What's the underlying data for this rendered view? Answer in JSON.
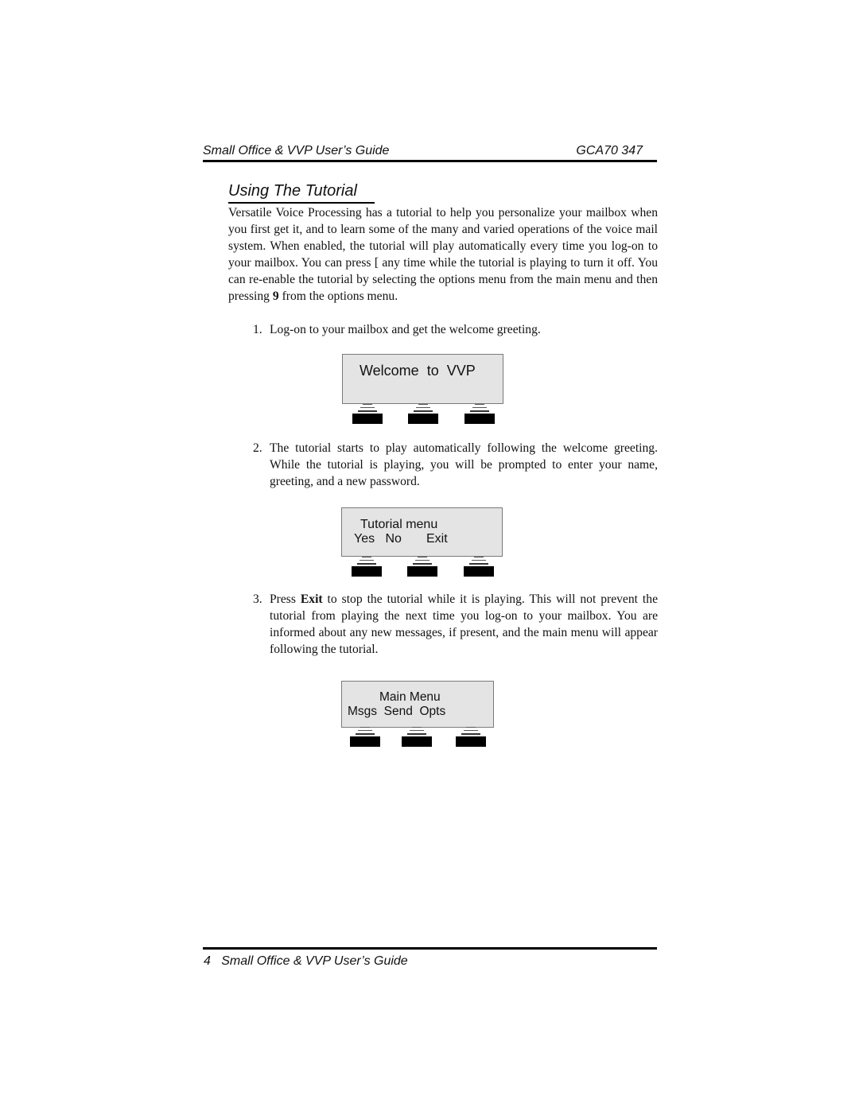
{
  "header": {
    "title": "Small Office & VVP User’s Guide",
    "code": "GCA70 347"
  },
  "section": {
    "title": "Using The Tutorial"
  },
  "intro": {
    "part1": "Versatile Voice Processing has a tutorial to help you personalize your mailbox when you first get it, and to learn some of the many and varied operations of the voice mail system. When enabled, the tutorial will play automatically every time you log-on to your mailbox. You can press [   any time while the tutorial is playing to turn it off. You can re-enable the tutorial by selecting the options menu from the main menu and then pressing ",
    "bold": "9",
    "part2": " from the options menu."
  },
  "steps": [
    {
      "number": "1.",
      "text": "Log-on to your mailbox and get the welcome greeting."
    },
    {
      "number": "2.",
      "text": "The tutorial starts to play automatically following the welcome greeting. While the tutorial is playing, you will be prompted to enter your name, greeting, and a new password."
    },
    {
      "number": "3.",
      "pre": "Press ",
      "bold": "Exit",
      "post": " to stop the tutorial while it is playing. This will not prevent the tutorial from playing the next time you log-on to your mailbox. You are informed about any new messages, if present, and the main menu will appear following the tutorial."
    }
  ],
  "displays": [
    {
      "line1": "Welcome  to  VVP",
      "line2": ""
    },
    {
      "line1": "Tutorial menu",
      "line2": "Yes   No       Exit"
    },
    {
      "line1": "Main Menu",
      "line2": "Msgs  Send  Opts"
    }
  ],
  "softkeys": {
    "icon": "softkey-button-icon",
    "count_per_display": 3
  },
  "footer": {
    "page_number": "4",
    "title": "Small Office & VVP User’s Guide"
  }
}
